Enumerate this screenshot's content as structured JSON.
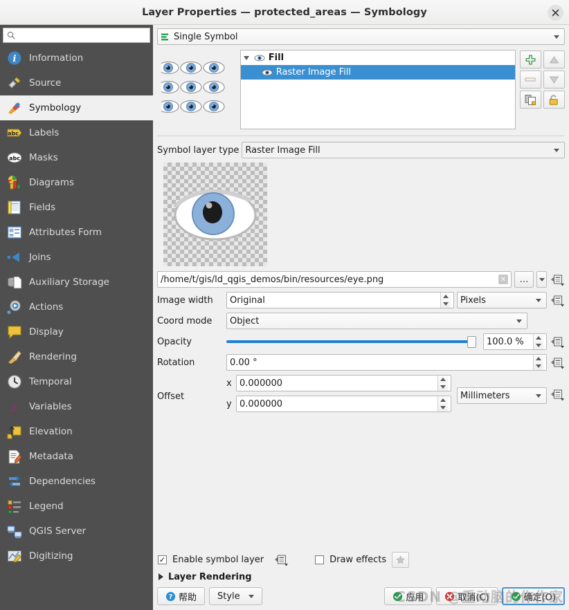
{
  "window": {
    "title": "Layer Properties — protected_areas — Symbology",
    "close_label": "✕",
    "close_icon": "close-icon"
  },
  "sidebar": {
    "search": {
      "value": "",
      "placeholder": "",
      "icon": "search-icon"
    },
    "items": [
      {
        "label": "Information",
        "icon": "information-icon",
        "active": false
      },
      {
        "label": "Source",
        "icon": "source-icon",
        "active": false
      },
      {
        "label": "Symbology",
        "icon": "symbology-brush-icon",
        "active": true
      },
      {
        "label": "Labels",
        "icon": "labels-abc-icon",
        "active": false
      },
      {
        "label": "Masks",
        "icon": "masks-abc-icon",
        "active": false
      },
      {
        "label": "Diagrams",
        "icon": "diagrams-chart-icon",
        "active": false
      },
      {
        "label": "Fields",
        "icon": "fields-table-icon",
        "active": false
      },
      {
        "label": "Attributes Form",
        "icon": "attributes-form-icon",
        "active": false
      },
      {
        "label": "Joins",
        "icon": "joins-icon",
        "active": false
      },
      {
        "label": "Auxiliary Storage",
        "icon": "auxiliary-storage-icon",
        "active": false
      },
      {
        "label": "Actions",
        "icon": "actions-gear-icon",
        "active": false
      },
      {
        "label": "Display",
        "icon": "display-balloon-icon",
        "active": false
      },
      {
        "label": "Rendering",
        "icon": "rendering-brush-icon",
        "active": false
      },
      {
        "label": "Temporal",
        "icon": "temporal-clock-icon",
        "active": false
      },
      {
        "label": "Variables",
        "icon": "variables-epsilon-icon",
        "active": false
      },
      {
        "label": "Elevation",
        "icon": "elevation-arrow-icon",
        "active": false
      },
      {
        "label": "Metadata",
        "icon": "metadata-pencil-icon",
        "active": false
      },
      {
        "label": "Dependencies",
        "icon": "dependencies-icon",
        "active": false
      },
      {
        "label": "Legend",
        "icon": "legend-icon",
        "active": false
      },
      {
        "label": "QGIS Server",
        "icon": "qgis-server-icon",
        "active": false
      },
      {
        "label": "Digitizing",
        "icon": "digitizing-icon",
        "active": false
      }
    ]
  },
  "renderer": {
    "value": "Single Symbol",
    "icon": "single-symbol-icon"
  },
  "symbol_tree": {
    "rows": [
      {
        "label": "Fill",
        "icon": "eye-symbol-icon",
        "selected": false,
        "level": 0
      },
      {
        "label": "Raster Image Fill",
        "icon": "eye-symbol-icon",
        "selected": true,
        "level": 1
      }
    ],
    "buttons": [
      {
        "name": "add-symbol-layer-button",
        "icon": "plus-icon"
      },
      {
        "name": "move-symbol-layer-up-button",
        "icon": "triangle-up-icon"
      },
      {
        "name": "remove-symbol-layer-button",
        "icon": "minus-icon"
      },
      {
        "name": "move-symbol-layer-down-button",
        "icon": "triangle-down-icon"
      },
      {
        "name": "duplicate-symbol-layer-button",
        "icon": "copy-icon"
      },
      {
        "name": "lock-symbol-layer-button",
        "icon": "unlock-icon"
      }
    ]
  },
  "form": {
    "symbol_layer_type": {
      "label": "Symbol layer type",
      "value": "Raster Image Fill"
    },
    "image_path": {
      "value": "/home/t/gis/ld_qgis_demos/bin/resources/eye.png",
      "browse_label": "…"
    },
    "image_width": {
      "label": "Image width",
      "value": "Original",
      "unit": "Pixels"
    },
    "coord_mode": {
      "label": "Coord mode",
      "value": "Object"
    },
    "opacity": {
      "label": "Opacity",
      "value": "100.0 %",
      "percent": 100
    },
    "rotation": {
      "label": "Rotation",
      "value": "0.00 °"
    },
    "offset": {
      "label": "Offset",
      "x_label": "x",
      "y_label": "y",
      "x_value": "0.000000",
      "y_value": "0.000000",
      "unit": "Millimeters"
    }
  },
  "bottom": {
    "enable_symbol_layer": {
      "label": "Enable symbol layer",
      "checked": true,
      "mark": "✓"
    },
    "draw_effects": {
      "label": "Draw effects",
      "checked": false,
      "mark": ""
    },
    "layer_rendering": {
      "label": "Layer Rendering",
      "expanded": false
    },
    "help_button": {
      "label": "帮助",
      "icon": "help-question-icon"
    },
    "style_button": {
      "label": "Style"
    },
    "apply_button": {
      "label": "应用",
      "icon": "check-green-icon"
    },
    "cancel_button": {
      "label": "取消(C)",
      "icon": "cancel-red-icon"
    },
    "ok_button": {
      "label": "确定(O)",
      "icon": "check-green-icon"
    },
    "watermark": "CSDN @重动脑的作作家"
  },
  "colors": {
    "selection_blue": "#3a8fd0",
    "sidebar_bg": "#4f4f4f",
    "panel_bg": "#f0f0f0",
    "slider_blue": "#1f7fd4",
    "accent_green": "#2aa44f"
  }
}
